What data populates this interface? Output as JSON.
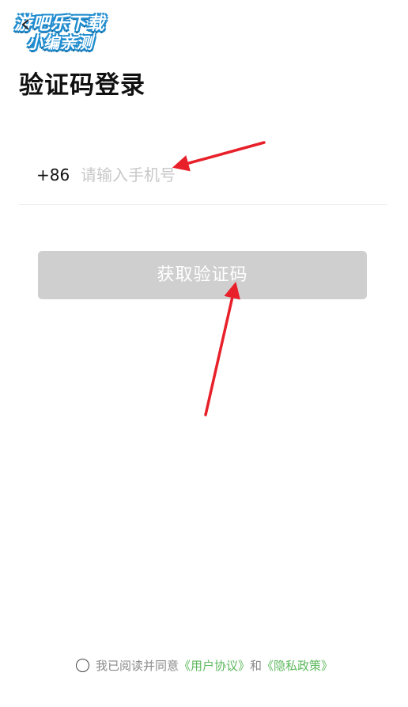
{
  "watermark": {
    "line1": "游吧乐下载",
    "line2": "小编亲测"
  },
  "header": {
    "title": "验证码登录"
  },
  "phone": {
    "country_code": "+86",
    "placeholder": "请输入手机号",
    "value": ""
  },
  "actions": {
    "get_code_label": "获取验证码"
  },
  "agreement": {
    "prefix": "我已阅读并同意",
    "user_agreement": "《用户协议》",
    "conjunction": "和",
    "privacy_policy": "《隐私政策》"
  },
  "colors": {
    "button_disabled": "#cfcfcf",
    "link": "#5cb85c",
    "annotation_arrow": "#e8202a"
  }
}
